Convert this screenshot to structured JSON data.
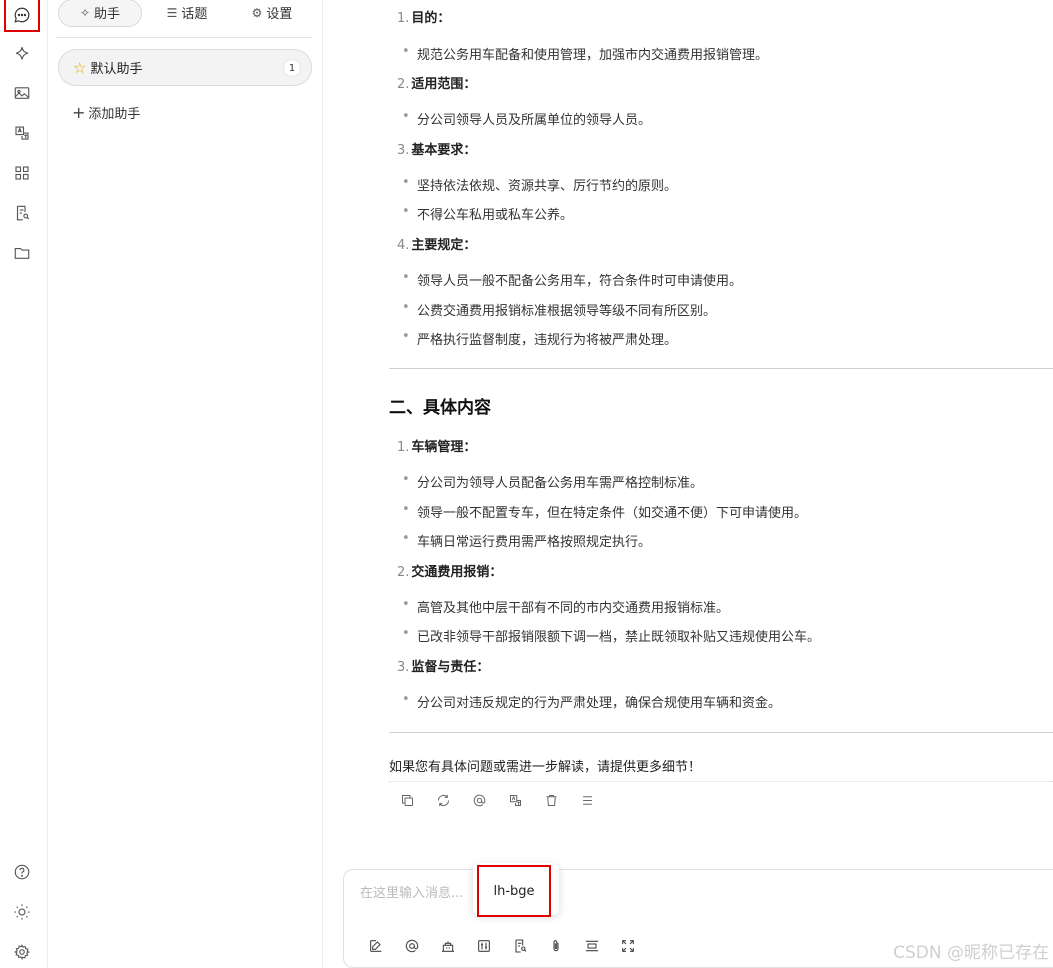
{
  "rail": {
    "items": [
      "chat-icon",
      "sparkle-icon",
      "image-icon",
      "translate-icon",
      "apps-icon",
      "document-search-icon",
      "folder-icon"
    ],
    "bottom": [
      "help-icon",
      "theme-icon",
      "settings-icon"
    ]
  },
  "panel": {
    "tabs": [
      {
        "label": "助手",
        "icon": "sparkle-icon"
      },
      {
        "label": "话题",
        "icon": "list-icon"
      },
      {
        "label": "设置",
        "icon": "gear-icon"
      }
    ],
    "assistant": {
      "name": "默认助手",
      "count": "1"
    },
    "add_label": "添加助手"
  },
  "doc": {
    "section1": [
      {
        "num": "1.",
        "title": "目的：",
        "items": [
          "规范公务用车配备和使用管理，加强市内交通费用报销管理。"
        ]
      },
      {
        "num": "2.",
        "title": "适用范围：",
        "items": [
          "分公司领导人员及所属单位的领导人员。"
        ]
      },
      {
        "num": "3.",
        "title": "基本要求：",
        "items": [
          "坚持依法依规、资源共享、厉行节约的原则。",
          "不得公车私用或私车公养。"
        ]
      },
      {
        "num": "4.",
        "title": "主要规定：",
        "items": [
          "领导人员一般不配备公务用车，符合条件时可申请使用。",
          "公费交通费用报销标准根据领导等级不同有所区别。",
          "严格执行监督制度，违规行为将被严肃处理。"
        ]
      }
    ],
    "heading2": "二、具体内容",
    "section2": [
      {
        "num": "1.",
        "title": "车辆管理：",
        "items": [
          "分公司为领导人员配备公务用车需严格控制标准。",
          "领导一般不配置专车，但在特定条件（如交通不便）下可申请使用。",
          "车辆日常运行费用需严格按照规定执行。"
        ]
      },
      {
        "num": "2.",
        "title": "交通费用报销：",
        "items": [
          "高管及其他中层干部有不同的市内交通费用报销标准。",
          "已改非领导干部报销限额下调一档，禁止既领取补贴又违规使用公车。"
        ]
      },
      {
        "num": "3.",
        "title": "监督与责任：",
        "items": [
          "分公司对违反规定的行为严肃处理，确保合规使用车辆和资金。"
        ]
      }
    ],
    "closing": "如果您有具体问题或需进一步解读，请提供更多细节！"
  },
  "message_tools": [
    "copy-icon",
    "regenerate-icon",
    "mention-icon",
    "translate-icon",
    "delete-icon",
    "menu-icon"
  ],
  "input": {
    "placeholder": "在这里输入消息...",
    "tools": [
      "edit-icon",
      "mention-icon",
      "knowledge-icon",
      "settings-sliders-icon",
      "document-search-icon",
      "attachment-icon",
      "collapse-icon",
      "fullscreen-icon"
    ]
  },
  "tooltip": {
    "text": "lh-bge"
  },
  "watermark": "CSDN @昵称已存在"
}
